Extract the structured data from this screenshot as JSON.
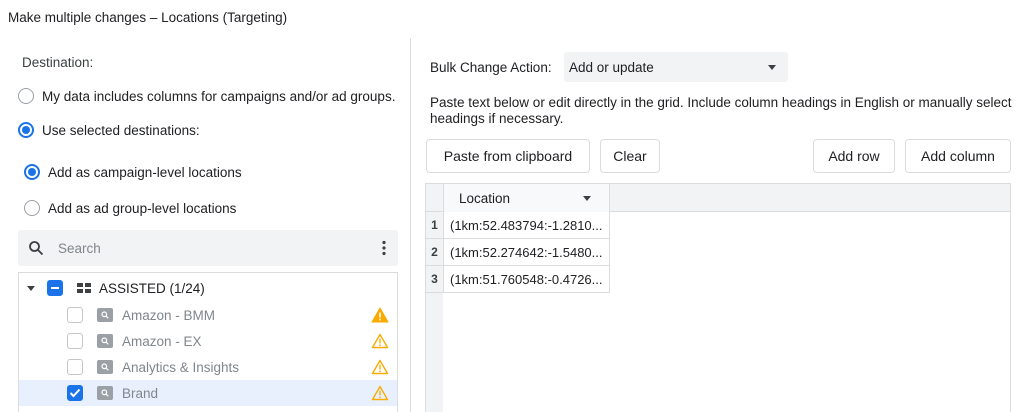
{
  "window": {
    "title": "Make multiple changes – Locations (Targeting)"
  },
  "destination": {
    "label": "Destination:",
    "options": [
      {
        "label": "My data includes columns for campaigns and/or ad groups.",
        "selected": false
      },
      {
        "label": "Use selected destinations:",
        "selected": true
      }
    ],
    "level_options": [
      {
        "label": "Add as campaign-level locations",
        "selected": true
      },
      {
        "label": "Add as ad group-level locations",
        "selected": false
      }
    ]
  },
  "search": {
    "placeholder": "Search",
    "value": ""
  },
  "tree": {
    "account": {
      "label": "ASSISTED (1/24)",
      "state": "indeterminate"
    },
    "campaigns": [
      {
        "label": "Amazon - BMM",
        "checked": false,
        "warning": "filled"
      },
      {
        "label": "Amazon - EX",
        "checked": false,
        "warning": "outline"
      },
      {
        "label": "Analytics & Insights",
        "checked": false,
        "warning": "outline"
      },
      {
        "label": "Brand",
        "checked": true,
        "warning": "outline"
      }
    ]
  },
  "bulk": {
    "label": "Bulk Change Action:",
    "value": "Add or update",
    "instructions": "Paste text below or edit directly in the grid. Include column headings in English or manually select headings if necessary."
  },
  "toolbar": {
    "paste_label": "Paste from clipboard",
    "clear_label": "Clear",
    "add_row_label": "Add row",
    "add_column_label": "Add column"
  },
  "grid": {
    "column_header": "Location",
    "rows": [
      {
        "num": "1",
        "value": "(1km:52.483794:-1.2810..."
      },
      {
        "num": "2",
        "value": "(1km:52.274642:-1.5480..."
      },
      {
        "num": "3",
        "value": "(1km:51.760548:-0.4726..."
      }
    ]
  },
  "colors": {
    "accent": "#1a73e8",
    "warning": "#f9ab00",
    "panel_bg": "#f1f3f4",
    "border": "#dadce0"
  }
}
